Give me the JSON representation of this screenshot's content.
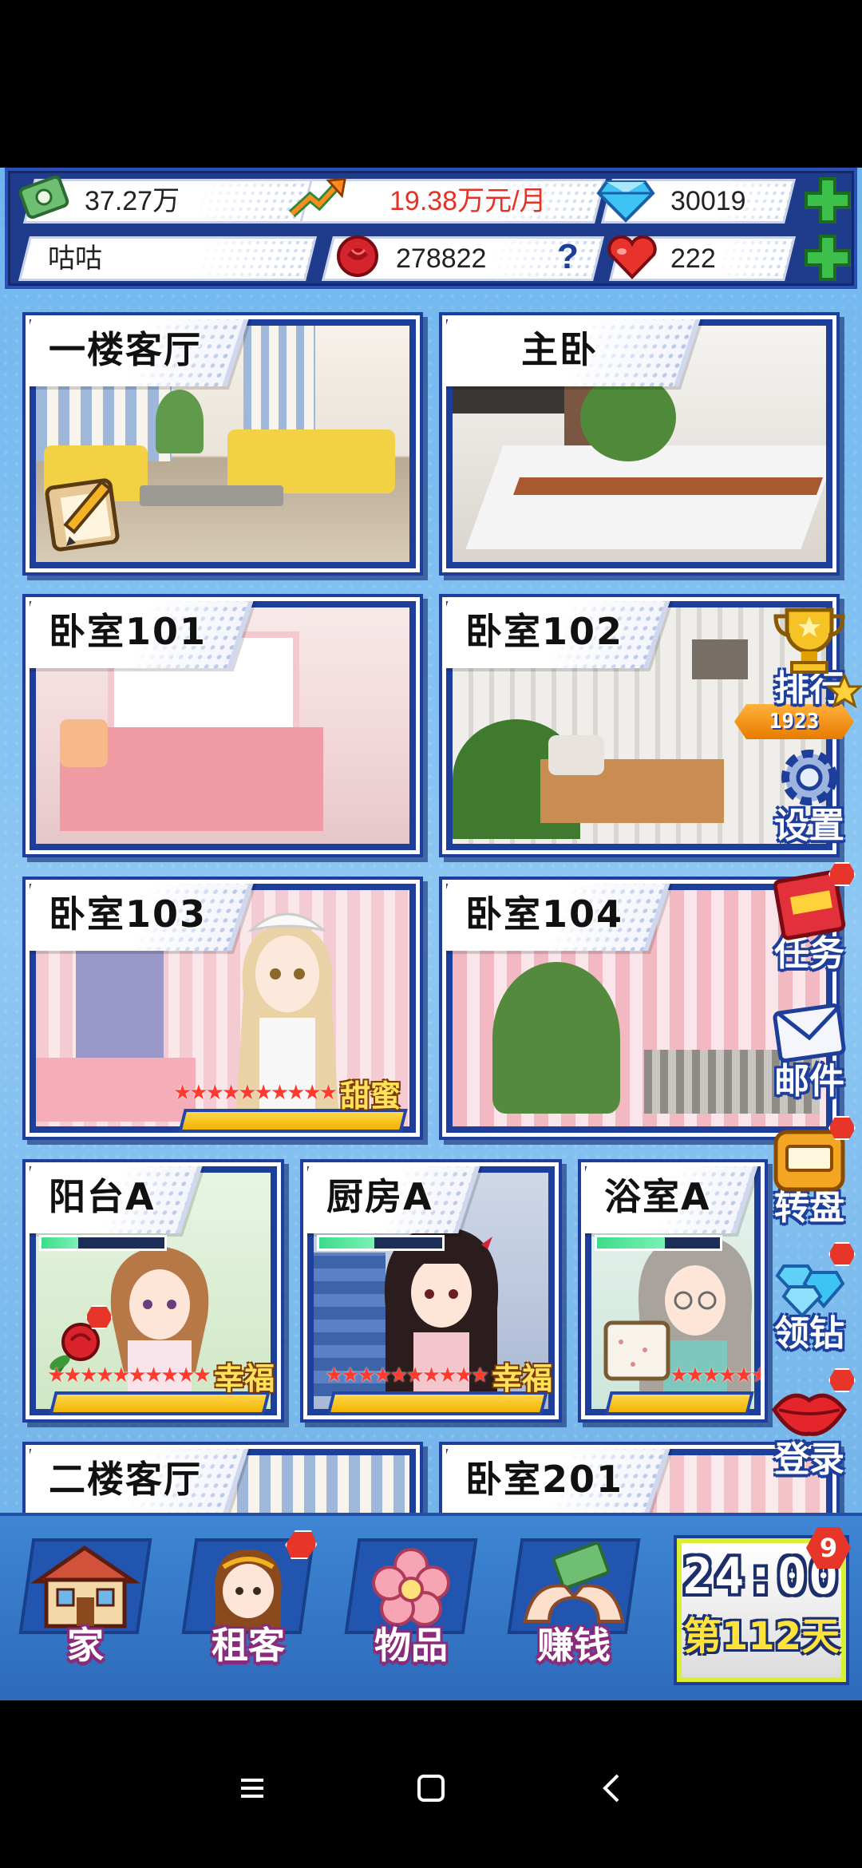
{
  "header": {
    "money": "37.27万",
    "income": "19.38万元/月",
    "diamonds": "30019",
    "player_name": "咕咕",
    "roses": "278822",
    "help": "?",
    "hearts": "222"
  },
  "rooms": [
    {
      "label": "一楼客厅"
    },
    {
      "label": "主卧"
    },
    {
      "label": "卧室101"
    },
    {
      "label": "卧室102"
    },
    {
      "label": "卧室103",
      "mood": "甜蜜",
      "stars": "★★★★★★★★★★"
    },
    {
      "label": "卧室104"
    },
    {
      "label": "阳台A",
      "mood": "幸福",
      "stars": "★★★★★★★★★★"
    },
    {
      "label": "厨房A",
      "mood": "幸福",
      "stars": "★★★★★★★★★★"
    },
    {
      "label": "浴室A",
      "stars": "★★★★★★★★★★"
    },
    {
      "label": "二楼客厅"
    },
    {
      "label": "卧室201"
    }
  ],
  "side_menu": {
    "rank_label": "排行",
    "rank_value": "1923",
    "settings_label": "设置",
    "tasks_label": "任务",
    "mail_label": "邮件",
    "wheel_label": "转盘",
    "diamond_label": "领钻",
    "login_label": "登录"
  },
  "bottom_nav": {
    "home": "家",
    "tenants": "租客",
    "items": "物品",
    "earn": "赚钱"
  },
  "clock": {
    "time": "24:00",
    "day": "第112天",
    "badge": "9"
  },
  "colors": {
    "income_text": "#e53224",
    "accent_blue": "#1d3e9a",
    "plus_green": "#2fb83a"
  }
}
